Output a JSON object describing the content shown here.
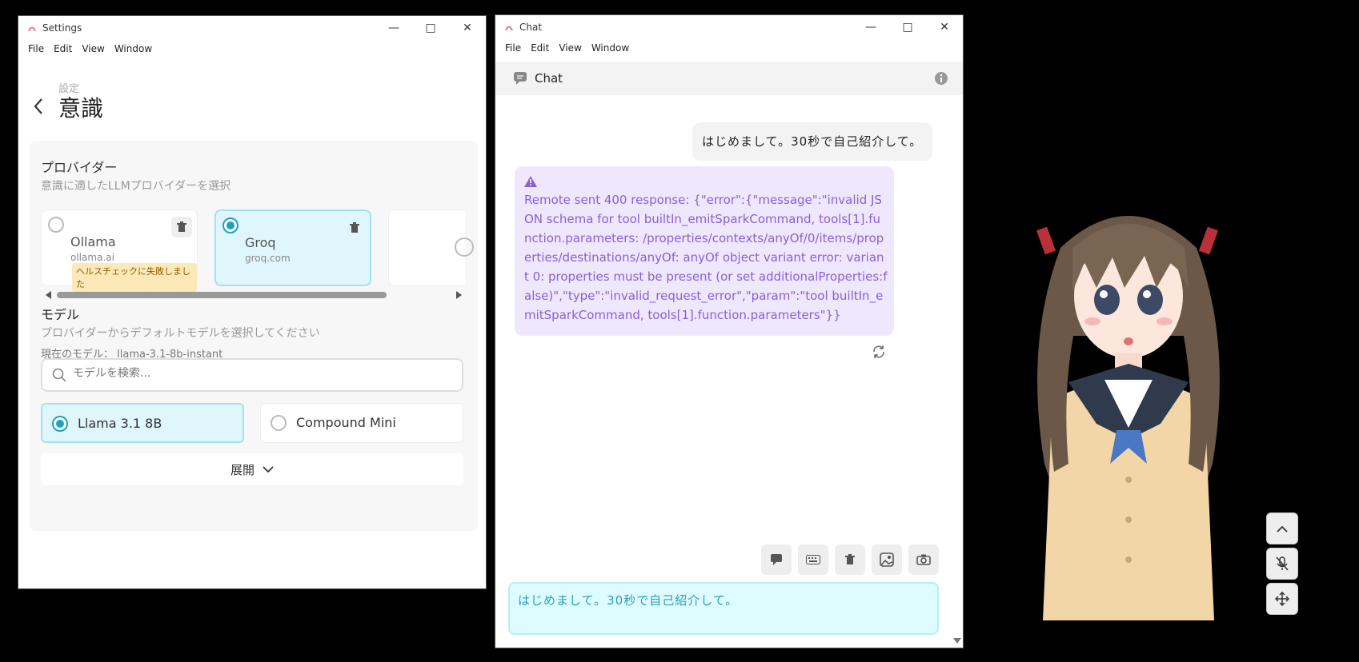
{
  "settings_window": {
    "title": "Settings",
    "menu": [
      "File",
      "Edit",
      "View",
      "Window"
    ],
    "breadcrumb": "設定",
    "page_title": "意識",
    "provider_section": {
      "title": "プロバイダー",
      "description": "意識に適したLLMプロバイダーを選択",
      "providers": [
        {
          "name": "Ollama",
          "url": "ollama.ai",
          "selected": false,
          "warning": "ヘルスチェックに失敗しました"
        },
        {
          "name": "Groq",
          "url": "groq.com",
          "selected": true
        }
      ]
    },
    "model_section": {
      "title": "モデル",
      "description": "プロバイダーからデフォルトモデルを選択してください",
      "current_label": "現在のモデル：",
      "current_value": "llama-3.1-8b-instant",
      "search_placeholder": "モデルを検索...",
      "models": [
        {
          "name": "Llama 3.1 8B",
          "selected": true
        },
        {
          "name": "Compound Mini",
          "selected": false
        }
      ],
      "expand_label": "展開"
    }
  },
  "chat_window": {
    "title": "Chat",
    "menu": [
      "File",
      "Edit",
      "View",
      "Window"
    ],
    "header_title": "Chat",
    "user_message": "はじめまして。30秒で自己紹介して。",
    "error_message": "Remote sent 400 response: {\"error\":{\"message\":\"invalid JSON schema for tool builtIn_emitSparkCommand, tools[1].function.parameters: /properties/contexts/anyOf/0/items/properties/destinations/anyOf: anyOf object variant error: variant 0: properties must be present (or set additionalProperties:false)\",\"type\":\"invalid_request_error\",\"param\":\"tool builtIn_emitSparkCommand, tools[1].function.parameters\"}}",
    "input_value": "はじめまして。30秒で自己紹介して。",
    "toolbar_icons": [
      "chat-bubble-icon",
      "keyboard-icon",
      "trash-icon",
      "image-icon",
      "camera-icon"
    ]
  },
  "colors": {
    "accent": "#1ba3bf",
    "selected_bg": "#dff6fa",
    "error_text": "#8b5fd6",
    "error_bg": "#efe8fd"
  }
}
